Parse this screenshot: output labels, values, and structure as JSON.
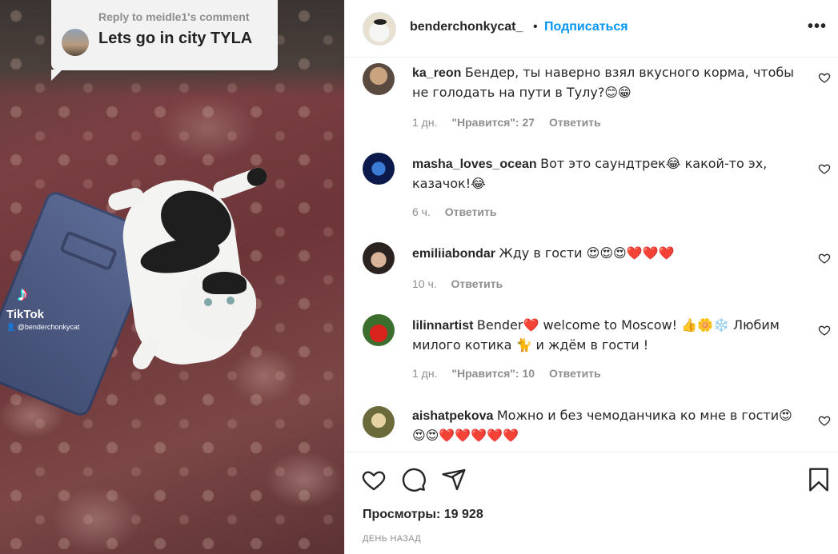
{
  "media": {
    "reply_meta": "Reply to meidle1's comment",
    "reply_text": "Lets go in city TYLA",
    "tiktok_word": "TikTok",
    "tiktok_handle": "@benderchonkycat"
  },
  "header": {
    "username": "benderchonkycat_",
    "separator": "•",
    "follow_label": "Подписаться",
    "more_label": "•••"
  },
  "comments": [
    {
      "username": "ka_reon",
      "text": "Бендер, ты наверно взял вкусного корма, чтобы не голодать на пути в Тулу?😊😁",
      "time": "1 дн.",
      "likes": "\"Нравится\": 27",
      "reply": "Ответить"
    },
    {
      "username": "masha_loves_ocean",
      "text": "Вот это саундтрек😂 какой-то эх, казачок!😂",
      "time": "6 ч.",
      "likes": "",
      "reply": "Ответить"
    },
    {
      "username": "emiliiabondar",
      "text": "Жду в гости 😍😍😍❤️❤️❤️",
      "time": "10 ч.",
      "likes": "",
      "reply": "Ответить"
    },
    {
      "username": "lilinnartist",
      "text": "Bender❤️ welcome to Moscow! 👍🌼❄️ Любим милого котика 🐈 и ждём в гости !",
      "time": "1 дн.",
      "likes": "\"Нравится\": 10",
      "reply": "Ответить"
    },
    {
      "username": "aishatpekova",
      "text": "Можно и без чемоданчика ко мне в гости😍😍😍❤️❤️❤️❤️❤️",
      "time": "",
      "likes": "",
      "reply": ""
    }
  ],
  "footer": {
    "views": "Просмотры: 19 928",
    "date": "ДЕНЬ НАЗАД"
  },
  "colors": {
    "accent": "#0095f6",
    "text": "#262626",
    "muted": "#8e8e8e",
    "border": "#efefef"
  },
  "icons": [
    "heart-icon",
    "comment-icon",
    "share-icon",
    "bookmark-icon",
    "more-icon",
    "tiktok-logo-icon"
  ]
}
